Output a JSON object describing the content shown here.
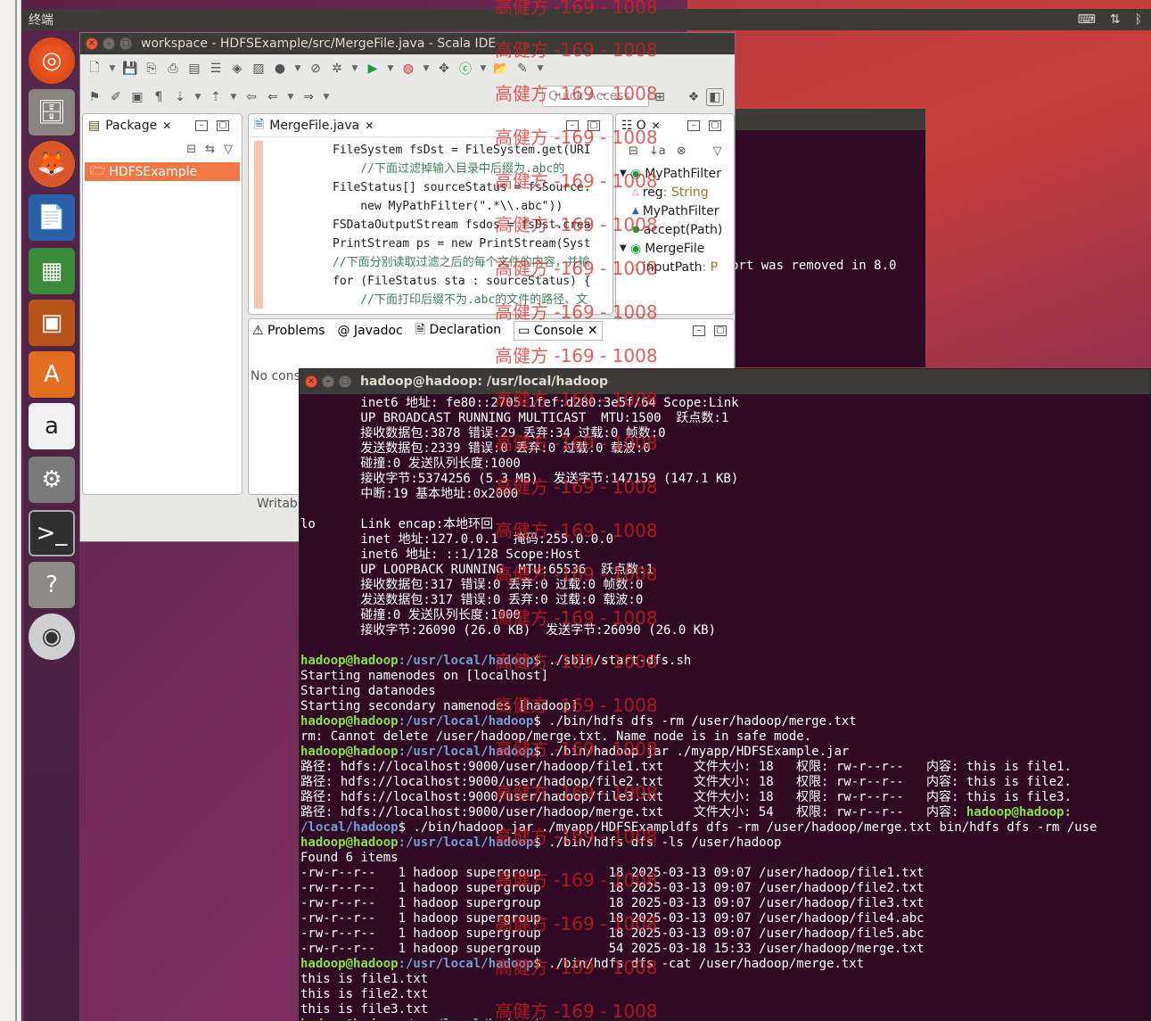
{
  "top_panel": {
    "app_title": "终端"
  },
  "eclipse": {
    "title": "workspace - HDFSExample/src/MergeFile.java - Scala IDE",
    "quick_access_placeholder": "Quick Access",
    "package_tab": "Package",
    "project_name": "HDFSExample",
    "editor_tab": "MergeFile.java",
    "outline_tab": "O",
    "code_lines": [
      "FileSystem fsDst = FileSystem.get(URI",
      "    //下面过滤掉输入目录中后缀为.abc的",
      "FileStatus[] sourceStatus = fsSource.",
      "    new MyPathFilter(\".*\\\\.abc\"))",
      "FSDataOutputStream fsdos = fsDst.crea",
      "PrintStream ps = new PrintStream(Syst",
      "//下面分别读取过滤之后的每个文件的内容，并输",
      "for (FileStatus sta : sourceStatus) {",
      "    //下面打印后缀不为.abc的文件的路径、文"
    ],
    "outline_items": [
      {
        "label": "MyPathFilter",
        "type": ""
      },
      {
        "label": "reg",
        "type": " : String"
      },
      {
        "label": "MyPathFilter",
        "type": ""
      },
      {
        "label": "accept(Path)",
        "type": ""
      },
      {
        "label": "MergeFile",
        "type": ""
      },
      {
        "label": "inputPath",
        "type": " : P"
      }
    ],
    "bottom_tabs": [
      "Problems",
      "Javadoc",
      "Declaration",
      "Console"
    ],
    "console_text": "No cons",
    "writable_text": "Writab"
  },
  "terminal_back": {
    "text": "ort was removed in 8.0"
  },
  "terminal": {
    "title": "hadoop@hadoop: /usr/local/hadoop",
    "prompt_user": "hadoop@hadoop",
    "prompt_path": ":/usr/local/hadoop",
    "lines_top": [
      "        inet6 地址: fe80::2705:1fef:d280:3e5f/64 Scope:Link",
      "        UP BROADCAST RUNNING MULTICAST  MTU:1500  跃点数:1",
      "        接收数据包:3878 错误:29 丢弃:34 过载:0 帧数:0",
      "        发送数据包:2339 错误:0 丢弃:0 过载:0 载波:0",
      "        碰撞:0 发送队列长度:1000",
      "        接收字节:5374256 (5.3 MB)  发送字节:147159 (147.1 KB)",
      "        中断:19 基本地址:0x2000",
      "",
      "lo      Link encap:本地环回",
      "        inet 地址:127.0.0.1  掩码:255.0.0.0",
      "        inet6 地址: ::1/128 Scope:Host",
      "        UP LOOPBACK RUNNING  MTU:65536  跃点数:1",
      "        接收数据包:317 错误:0 丢弃:0 过载:0 帧数:0",
      "        发送数据包:317 错误:0 丢弃:0 过载:0 载波:0",
      "        碰撞:0 发送队列长度:1000",
      "        接收字节:26090 (26.0 KB)  发送字节:26090 (26.0 KB)",
      ""
    ],
    "cmd1": "$ ./sbin/start-dfs.sh",
    "out1": [
      "Starting namenodes on [localhost]",
      "Starting datanodes",
      "Starting secondary namenodes [hadoop]"
    ],
    "cmd2": "$ ./bin/hdfs dfs -rm /user/hadoop/merge.txt",
    "out2": [
      "rm: Cannot delete /user/hadoop/merge.txt. Name node is in safe mode."
    ],
    "cmd3": "$ ./bin/hadoop jar ./myapp/HDFSExample.jar",
    "out3": [
      "路径: hdfs://localhost:9000/user/hadoop/file1.txt    文件大小: 18   权限: rw-r--r--   内容: this is file1.",
      "路径: hdfs://localhost:9000/user/hadoop/file2.txt    文件大小: 18   权限: rw-r--r--   内容: this is file2.",
      "路径: hdfs://localhost:9000/user/hadoop/file3.txt    文件大小: 18   权限: rw-r--r--   内容: this is file3."
    ],
    "out3_last": "路径: hdfs://localhost:9000/user/hadoop/merge.txt    文件大小: 54   权限: rw-r--r--   内容: ",
    "out3_tail_user": "hadoop@hadoop:",
    "wrap_path": "/local/hadoop",
    "wrap_cmd": "$ ./bin/hadoop jar ./myapp/HDFSExampldfs dfs -rm /user/hadoop/merge.txt bin/hdfs dfs -rm /use",
    "cmd4": "$ ./bin/hdfs dfs -ls /user/hadoop",
    "out4": [
      "Found 6 items",
      "-rw-r--r--   1 hadoop supergroup         18 2025-03-13 09:07 /user/hadoop/file1.txt",
      "-rw-r--r--   1 hadoop supergroup         18 2025-03-13 09:07 /user/hadoop/file2.txt",
      "-rw-r--r--   1 hadoop supergroup         18 2025-03-13 09:07 /user/hadoop/file3.txt",
      "-rw-r--r--   1 hadoop supergroup         18 2025-03-13 09:07 /user/hadoop/file4.abc",
      "-rw-r--r--   1 hadoop supergroup         18 2025-03-13 09:07 /user/hadoop/file5.abc",
      "-rw-r--r--   1 hadoop supergroup         54 2025-03-18 15:33 /user/hadoop/merge.txt"
    ],
    "cmd5": "$ ./bin/hdfs dfs -cat /user/hadoop/merge.txt",
    "out5": [
      "this is file1.txt",
      "this is file2.txt",
      "this is file3.txt"
    ],
    "cmd6": "$ "
  },
  "watermark": {
    "text": "高健方 -169 - 1008"
  }
}
